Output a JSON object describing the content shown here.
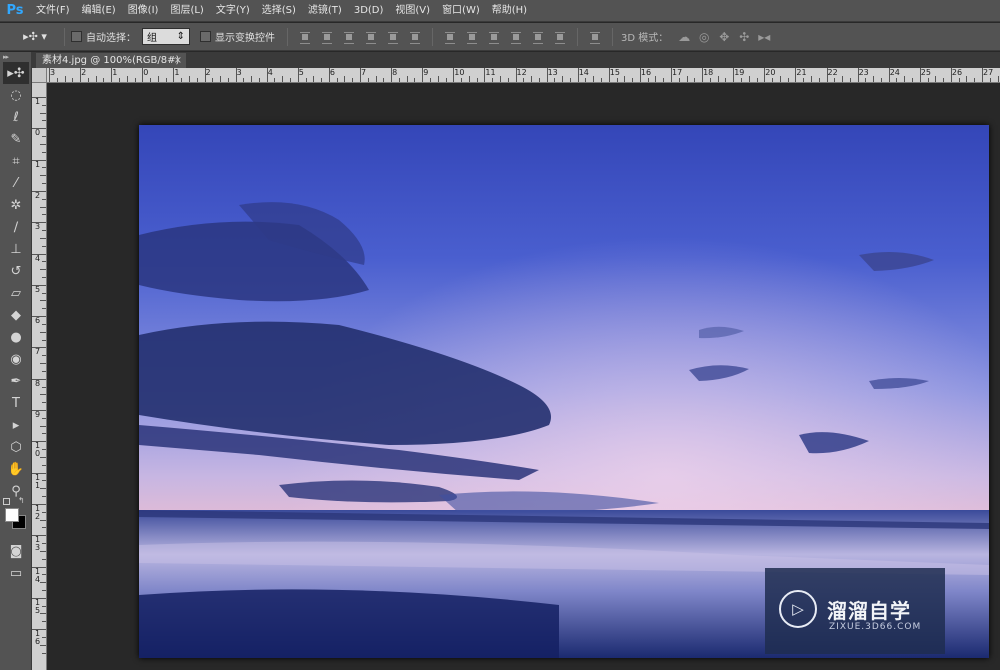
{
  "app": {
    "logo": "Ps"
  },
  "menu": [
    "文件(F)",
    "编辑(E)",
    "图像(I)",
    "图层(L)",
    "文字(Y)",
    "选择(S)",
    "滤镜(T)",
    "3D(D)",
    "视图(V)",
    "窗口(W)",
    "帮助(H)"
  ],
  "options": {
    "tool_preset_icon": "move-tool-icon",
    "auto_select_label": "自动选择：",
    "auto_select_checked": false,
    "auto_select_value": "组",
    "show_transform_label": "显示变换控件",
    "show_transform_checked": false,
    "mode3d_label": "3D 模式："
  },
  "document": {
    "tab_title": "素材4.jpg @ 100%(RGB/8#)",
    "close_glyph": "×"
  },
  "ruler": {
    "top_labels": [
      "3",
      "2",
      "1",
      "0",
      "1",
      "2",
      "3",
      "4",
      "5",
      "6",
      "7",
      "8",
      "9",
      "10",
      "11",
      "12",
      "13",
      "14",
      "15",
      "16",
      "17",
      "18",
      "19",
      "20",
      "21",
      "22",
      "23",
      "24",
      "25",
      "26",
      "27"
    ],
    "left_labels": [
      "1",
      "0",
      "1",
      "2",
      "3",
      "4",
      "5",
      "6",
      "7",
      "8",
      "9",
      "1 0",
      "1 1",
      "1 2",
      "1 3",
      "1 4",
      "1 5",
      "1 6"
    ]
  },
  "tools": [
    "move-tool-icon",
    "marquee-icon",
    "lasso-icon",
    "quick-select-icon",
    "crop-icon",
    "eyedropper-icon",
    "healing-icon",
    "brush-icon",
    "stamp-icon",
    "history-brush-icon",
    "eraser-icon",
    "bucket-icon",
    "blur-icon",
    "dodge-icon",
    "pen-icon",
    "type-icon",
    "path-select-icon",
    "shape-icon",
    "hand-icon",
    "zoom-icon"
  ],
  "colors": {
    "foreground": "#ffffff",
    "background": "#000000",
    "accent": "#31a8ff"
  },
  "watermark": {
    "title": "溜溜自学",
    "subtitle": "ZIXUE.3D66.COM"
  }
}
